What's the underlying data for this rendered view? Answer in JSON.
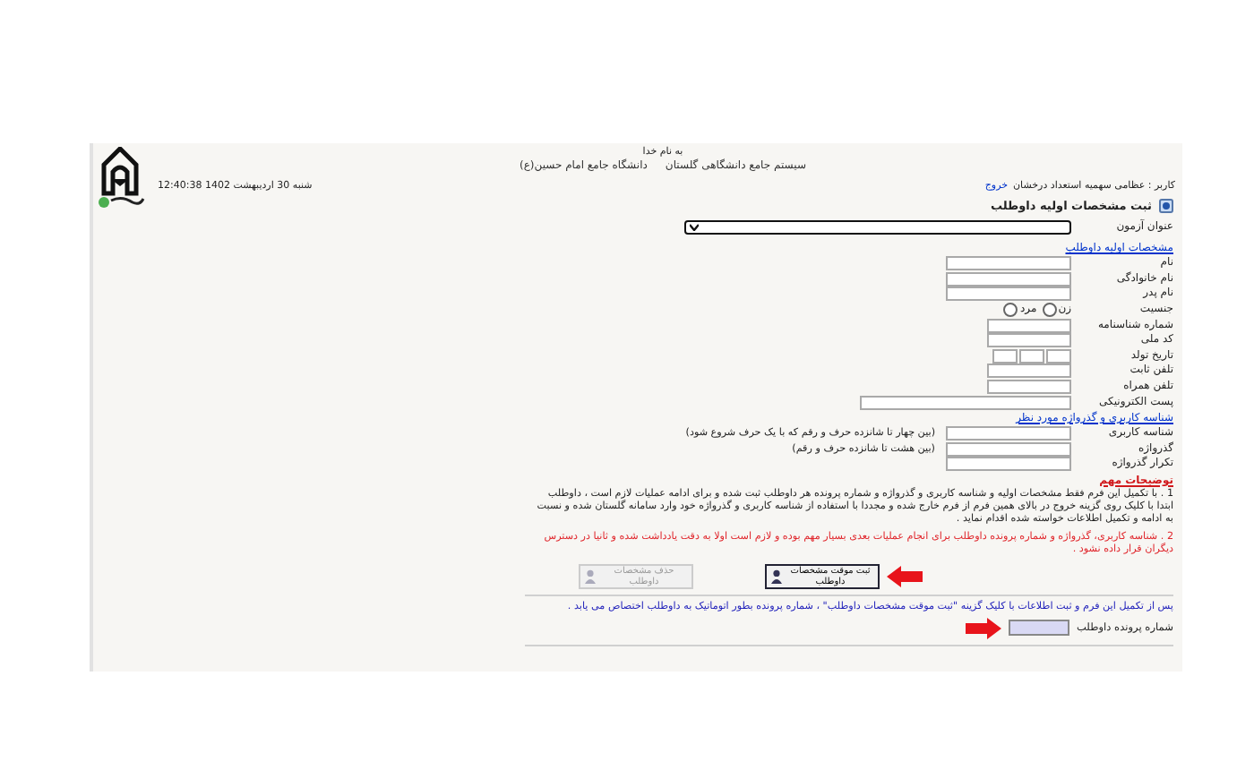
{
  "header": {
    "greeting": "به نام خدا",
    "system_name": "سیستم جامع دانشگاهی گلستان",
    "university": "دانشگاه جامع امام حسین(ع)",
    "datetime": "12:40:38 شنبه 30 اردیبهشت 1402"
  },
  "user_bar": {
    "user": "کاربر : عظامی سهمیه استعداد درخشان",
    "logout": "خروج"
  },
  "form_title": "ثبت مشخصات اولیه داوطلب",
  "exam": {
    "label": "عنوان آزمون"
  },
  "sections": [
    {
      "title": "مشخصات اولیه داوطلب",
      "fields": [
        {
          "label": "نام",
          "kind": "text"
        },
        {
          "label": "نام خانوادگی",
          "kind": "text"
        },
        {
          "label": "نام پدر",
          "kind": "text"
        },
        {
          "label": "جنسیت",
          "kind": "radio",
          "options": [
            {
              "label": "زن",
              "selected": false
            },
            {
              "label": "مرد",
              "selected": false
            }
          ]
        },
        {
          "label": "شماره شناسنامه",
          "kind": "short"
        },
        {
          "label": "کد ملی",
          "kind": "short"
        },
        {
          "label": "تاریخ تولد",
          "kind": "date"
        },
        {
          "label": "تلفن ثابت",
          "kind": "short"
        },
        {
          "label": "تلفن همراه",
          "kind": "short"
        },
        {
          "label": "پست الکترونیکی",
          "kind": "long"
        }
      ]
    },
    {
      "title": "شناسه کاربری و گذرواژه مورد نظر",
      "fields": [
        {
          "label": "شناسه کاربری",
          "kind": "text",
          "hint": "(بین چهار تا شانزده حرف و رقم که با یک حرف شروع شود)"
        },
        {
          "label": "گذرواژه",
          "kind": "text",
          "hint": "(بین هشت تا شانزده حرف و رقم)"
        },
        {
          "label": "تکرار گذرواژه",
          "kind": "text"
        }
      ]
    }
  ],
  "notes": {
    "title": "توضیحات مهم",
    "items": [
      {
        "kind": "info",
        "text": "1 . با تکمیل این فرم فقط مشخصات اولیه و شناسه کاربری و گذرواژه و شماره پرونده هر داوطلب ثبت شده و برای ادامه عملیات لازم است ، داوطلب ابتدا با کلیک روی گزینه خروج در بالای همین فرم از فرم خارج شده و مجددا با استفاده از شناسه کاربری و گذرواژه خود وارد سامانه گلستان شده و نسبت به ادامه و تکمیل اطلاعات خواسته شده اقدام نماید ."
      },
      {
        "kind": "warning",
        "text": "2 . شناسه کاربری، گذرواژه و شماره پرونده داوطلب برای انجام عملیات بعدی بسیار مهم بوده و لازم است اولا به دقت یادداشت شده و ثانیا در دسترس دیگران قرار داده نشود ."
      }
    ]
  },
  "buttons": [
    {
      "label": "ثبت موقت مشخصات داوطلب",
      "disabled": false,
      "marked": true
    },
    {
      "label": "حذف مشخصات داوطلب",
      "disabled": true,
      "marked": false
    }
  ],
  "info_text": "پس از تکمیل این فرم و ثبت اطلاعات با کلیک گزینه \"ثبت موقت مشخصات داوطلب\" ، شماره پرونده بطور اتوماتیک به داوطلب اختصاص می یابد .",
  "file_number": {
    "label": "شماره پرونده داوطلب",
    "marked": true
  }
}
